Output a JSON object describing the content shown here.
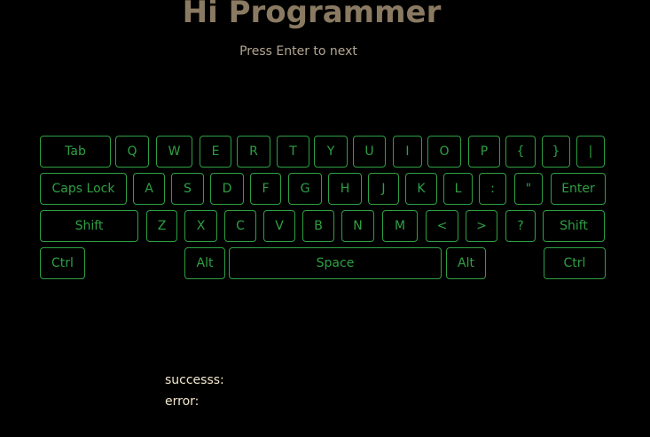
{
  "header": {
    "title": "Hi Programmer",
    "subtitle": "Press Enter to next"
  },
  "keyboard": {
    "row1": [
      "Tab",
      "Q",
      "W",
      "E",
      "R",
      "T",
      "Y",
      "U",
      "I",
      "O",
      "P",
      "{",
      "}",
      "|"
    ],
    "row2": [
      "Caps Lock",
      "A",
      "S",
      "D",
      "F",
      "G",
      "H",
      "J",
      "K",
      "L",
      ":",
      "\"",
      "Enter"
    ],
    "row3": [
      "Shift",
      "Z",
      "X",
      "C",
      "V",
      "B",
      "N",
      "M",
      "<",
      ">",
      "?",
      "Shift"
    ],
    "row4": [
      "Ctrl",
      "Alt",
      "Space",
      "Alt",
      "Ctrl"
    ]
  },
  "stats": {
    "success_label": "successs:",
    "error_label": "error:"
  },
  "colors": {
    "background": "#000000",
    "title": "#8a7a62",
    "key_accent": "#2ea043",
    "stats_text": "#f2e6cc"
  }
}
